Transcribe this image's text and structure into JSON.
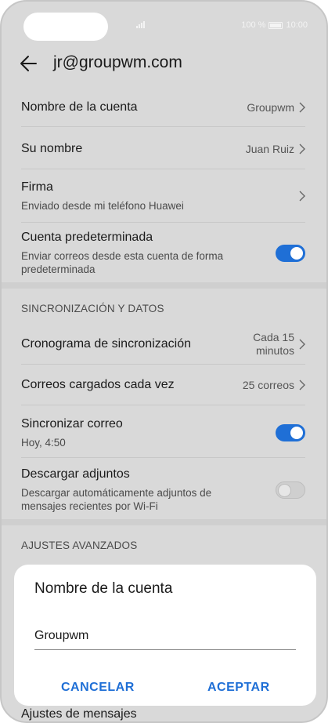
{
  "status": {
    "battery": "100 %",
    "time": "10:00"
  },
  "header": {
    "title": "jr@groupwm.com"
  },
  "rows": {
    "account_name": {
      "title": "Nombre de la cuenta",
      "value": "Groupwm"
    },
    "your_name": {
      "title": "Su nombre",
      "value": "Juan Ruiz"
    },
    "signature": {
      "title": "Firma",
      "sub": "Enviado desde mi teléfono Huawei"
    },
    "default_account": {
      "title": "Cuenta predeterminada",
      "sub1": "Enviar correos desde esta cuenta de forma",
      "sub2": "predeterminada",
      "toggle": "on"
    }
  },
  "sync_section": {
    "label": "SINCRONIZACIÓN Y DATOS",
    "schedule": {
      "title": "Cronograma de sincronización",
      "value1": "Cada 15",
      "value2": "minutos"
    },
    "loaded": {
      "title": "Correos cargados cada vez",
      "value": "25 correos"
    },
    "sync_mail": {
      "title": "Sincronizar correo",
      "sub": "Hoy, 4:50",
      "toggle": "on"
    },
    "download": {
      "title": "Descargar adjuntos",
      "sub1": "Descargar automáticamente adjuntos de",
      "sub2": "mensajes recientes por Wi-Fi",
      "toggle": "off"
    }
  },
  "advanced_section": {
    "label": "AJUSTES AVANZADOS"
  },
  "dialog": {
    "title": "Nombre de la cuenta",
    "input_value": "Groupwm",
    "cancel": "CANCELAR",
    "accept": "ACEPTAR"
  },
  "peek": {
    "text": "Ajustes de mensajes"
  },
  "colors": {
    "accent": "#1f6fd6",
    "background": "#d9d9d9"
  }
}
